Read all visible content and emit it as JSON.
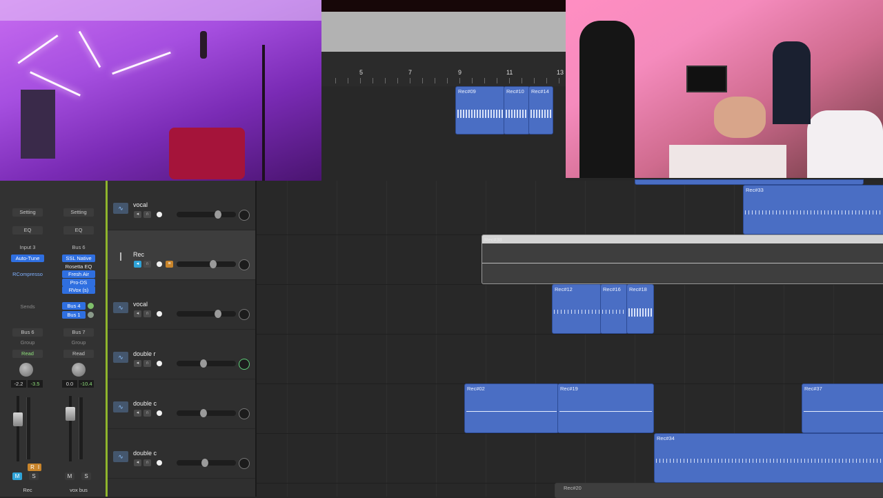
{
  "ruler": {
    "marks": [
      "5",
      "7",
      "9",
      "11",
      "13"
    ]
  },
  "mixer": {
    "strips": [
      {
        "setting": "Setting",
        "eq": "EQ",
        "input": "Input 3",
        "plugins": [
          "Auto-Tune",
          "RCompresso"
        ],
        "sends_label": "Sends",
        "sends": [],
        "output": "Bus 6",
        "group": "Group",
        "automation": "Read",
        "values": [
          "-2.2",
          "-3.5"
        ],
        "record": "R",
        "input_mon": "I",
        "mute": "M",
        "solo": "S",
        "name": "Rec"
      },
      {
        "setting": "Setting",
        "eq": "EQ",
        "input": "Bus 6",
        "plugins": [
          "SSL Native",
          "Rosetta EQ",
          "Fresh Air",
          "Pro-DS",
          "RVox (s)"
        ],
        "sends": [
          "Bus 4",
          "Bus 1"
        ],
        "output": "Bus 7",
        "group": "Group",
        "automation": "Read",
        "values": [
          "0.0",
          "-10.4"
        ],
        "mute": "M",
        "solo": "S",
        "name": "vox bus"
      }
    ]
  },
  "tracks": [
    {
      "name": "vocal"
    },
    {
      "name": "Rec"
    },
    {
      "name": "vocal"
    },
    {
      "name": "double r"
    },
    {
      "name": "double c"
    },
    {
      "name": "double c"
    }
  ],
  "regions": {
    "top": [
      "Rec#09",
      "Rec#10",
      "Rec#14"
    ],
    "rec33": "Rec#33",
    "rec38": "Rec#38",
    "lane3": [
      "Rec#12",
      "Rec#16",
      "Rec#18"
    ],
    "lane5": [
      "Rec#02",
      "Rec#19",
      "Rec#37"
    ],
    "lane6": [
      "Rec#34"
    ],
    "bottom": "Rec#20"
  },
  "colors": {
    "region_blue": "#4a6ec4",
    "plugin_blue": "#2f6fe0",
    "playhead_green": "#8fb52c"
  }
}
